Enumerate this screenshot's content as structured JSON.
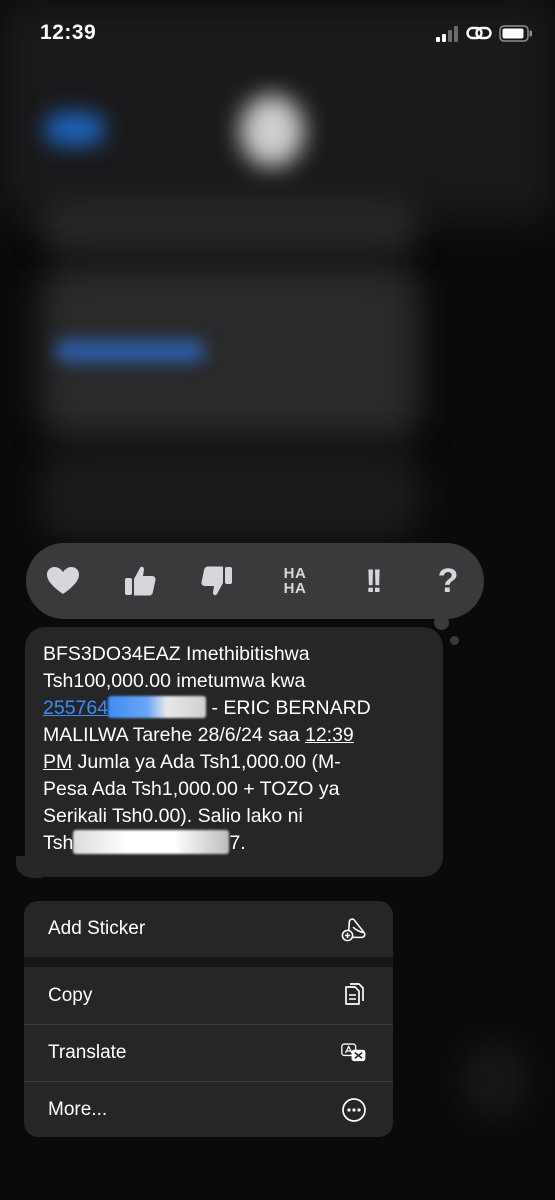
{
  "status_bar": {
    "time": "12:39",
    "icons": [
      "cellular-signal-icon",
      "link-icon",
      "battery-icon"
    ]
  },
  "reactions": [
    {
      "name": "heart",
      "icon": "heart-icon"
    },
    {
      "name": "thumbs-up",
      "icon": "thumbs-up-icon"
    },
    {
      "name": "thumbs-down",
      "icon": "thumbs-down-icon"
    },
    {
      "name": "haha",
      "label_top": "HA",
      "label_bottom": "HA"
    },
    {
      "name": "emphasize",
      "label": "!!"
    },
    {
      "name": "question",
      "label": "?"
    }
  ],
  "message": {
    "line1": "BFS3DO34EAZ Imethibitishwa",
    "line2": "Tsh100,000.00 imetumwa kwa",
    "phone_visible": "255764",
    "line3_rest": " - ERIC BERNARD",
    "line4_pre": "MALILWA Tarehe 28/6/24 saa ",
    "time_link": "12:39",
    "line5_pm": "PM",
    "line5_rest": " Jumla ya Ada Tsh1,000.00 (M-",
    "line6": "Pesa Ada Tsh1,000.00 + TOZO ya",
    "line7": "Serikali Tsh0.00). Salio lako ni",
    "line8_pre": "Tsh",
    "line8_post": "7."
  },
  "menu": {
    "items": [
      {
        "label": "Add Sticker",
        "icon": "add-sticker-icon"
      },
      {
        "label": "Copy",
        "icon": "copy-icon"
      },
      {
        "label": "Translate",
        "icon": "translate-icon"
      },
      {
        "label": "More...",
        "icon": "more-icon"
      }
    ]
  },
  "colors": {
    "background": "#0a0a0a",
    "bubble": "#262628",
    "reaction_bar": "#3a3a3c",
    "link": "#3e8cf2",
    "menu": "#262628"
  }
}
